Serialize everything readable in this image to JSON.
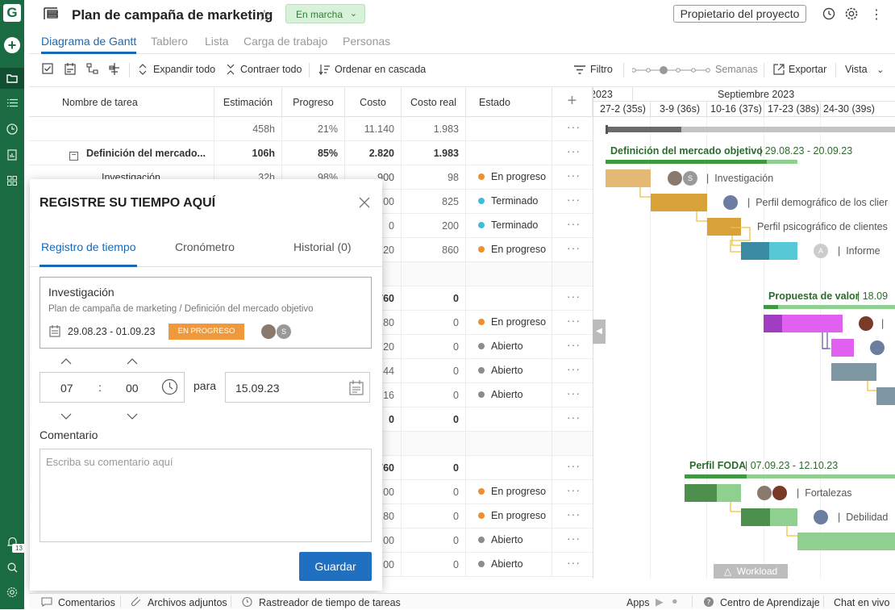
{
  "app": {
    "logo_letter": "G",
    "notification_count": "13"
  },
  "header": {
    "title": "Plan de campaña de marketing",
    "status": "En marcha",
    "owner_button": "Propietario del proyecto",
    "tabs": [
      "Diagrama de Gantt",
      "Tablero",
      "Lista",
      "Carga de trabajo",
      "Personas"
    ]
  },
  "toolbar": {
    "expand_all": "Expandir todo",
    "collapse_all": "Contraer todo",
    "cascade_sort": "Ordenar en cascada",
    "filter": "Filtro",
    "zoom_label": "Semanas",
    "export": "Exportar",
    "view": "Vista"
  },
  "grid": {
    "columns": [
      "Nombre de tarea",
      "Estimación",
      "Progreso",
      "Costo",
      "Costo real",
      "Estado"
    ],
    "summary": {
      "estimate": "458h",
      "progress": "21%",
      "cost": "11.140",
      "actual": "1.983"
    },
    "group1": {
      "name": "Definición del mercado...",
      "estimate": "106h",
      "progress": "85%",
      "cost": "2.820",
      "actual": "1.983"
    },
    "row_partial": {
      "name": "Investigación",
      "estimate": "32h",
      "progress": "98%",
      "cost": "900"
    },
    "rows": [
      {
        "cost": "900",
        "actual": "98",
        "status": "En progreso",
        "color": "#ef8f2e"
      },
      {
        "cost": "00",
        "actual": "825",
        "status": "Terminado",
        "color": "#40bcd8"
      },
      {
        "cost": "0",
        "actual": "200",
        "status": "Terminado",
        "color": "#40bcd8"
      },
      {
        "cost": "20",
        "actual": "860",
        "status": "En progreso",
        "color": "#ef8f2e"
      },
      {
        "cost": "",
        "actual": "",
        "status": "",
        "color": ""
      },
      {
        "cost": "760",
        "actual": "0",
        "status": "",
        "color": "",
        "bold": true
      },
      {
        "cost": "80",
        "actual": "0",
        "status": "En progreso",
        "color": "#ef8f2e"
      },
      {
        "cost": "20",
        "actual": "0",
        "status": "Abierto",
        "color": "#8c8c8c"
      },
      {
        "cost": "44",
        "actual": "0",
        "status": "Abierto",
        "color": "#8c8c8c"
      },
      {
        "cost": "16",
        "actual": "0",
        "status": "Abierto",
        "color": "#8c8c8c"
      },
      {
        "cost": "0",
        "actual": "0",
        "status": "",
        "color": "",
        "bold": true
      },
      {
        "cost": "",
        "actual": "",
        "status": "",
        "color": ""
      },
      {
        "cost": "760",
        "actual": "0",
        "status": "",
        "color": "",
        "bold": true
      },
      {
        "cost": "00",
        "actual": "0",
        "status": "En progreso",
        "color": "#ef8f2e"
      },
      {
        "cost": "80",
        "actual": "0",
        "status": "En progreso",
        "color": "#ef8f2e"
      },
      {
        "cost": "00",
        "actual": "0",
        "status": "Abierto",
        "color": "#8c8c8c"
      },
      {
        "cost": "00",
        "actual": "0",
        "status": "Abierto",
        "color": "#8c8c8c"
      }
    ]
  },
  "gantt": {
    "month_prev": "2023",
    "month": "Septiembre 2023",
    "weeks": [
      "27-2 (35s)",
      "3-9 (36s)",
      "10-16 (37s)",
      "17-23 (38s)",
      "24-30 (39s)"
    ],
    "group1_label": "Definición del mercado objetivo",
    "group1_dates": "29.08.23 - 20.09.23",
    "tasks1": [
      "Investigación",
      "Perfil demográfico de los clier",
      "Perfil psicográfico de clientes",
      "Informe"
    ],
    "group2_label": "Propuesta de valor",
    "group2_dates": "18.09",
    "group3_label": "Perfil FODA",
    "group3_dates": "07.09.23 - 12.10.23",
    "tasks3": [
      "Fortalezas",
      "Debilidad"
    ],
    "workload": "Workload"
  },
  "dialog": {
    "title": "REGISTRE SU TIEMPO AQUÍ",
    "tabs": [
      "Registro de tiempo",
      "Cronómetro",
      "Historial (0)"
    ],
    "task_name": "Investigación",
    "task_path": "Plan de campaña de marketing / Definición del mercado objetivo",
    "task_dates": "29.08.23 - 01.09.23",
    "task_status": "EN PROGRESO",
    "hours": "07",
    "minutes": "00",
    "sep": ":",
    "para": "para",
    "date": "15.09.23",
    "comment_label": "Comentario",
    "comment_placeholder": "Escriba su comentario aquí",
    "save": "Guardar"
  },
  "footer": {
    "comments": "Comentarios",
    "attachments": "Archivos adjuntos",
    "time_tracker": "Rastreador de tiempo de tareas",
    "apps": "Apps",
    "learning": "Centro de Aprendizaje",
    "chat": "Chat en vivo"
  }
}
